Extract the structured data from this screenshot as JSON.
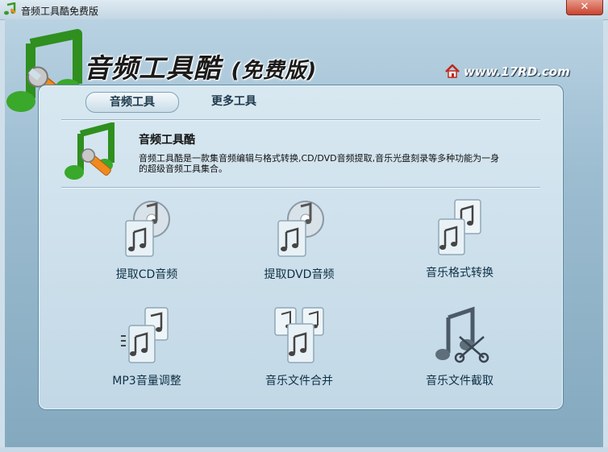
{
  "window": {
    "title": "音频工具酷免费版",
    "close_label": "✕"
  },
  "header": {
    "app_title": "音频工具酷",
    "app_title_sub": "(免费版)",
    "site": "www.17RD.com"
  },
  "tabs": [
    {
      "label": "音频工具",
      "active": true
    },
    {
      "label": "更多工具",
      "active": false
    }
  ],
  "intro": {
    "title": "音频工具酷",
    "description": "音频工具酷是一款集音频编辑与格式转换,CD/DVD音频提取,音乐光盘刻录等多种功能为一身的超级音频工具集合。"
  },
  "tools": [
    {
      "label": "提取CD音频",
      "icon": "cd-extract-icon"
    },
    {
      "label": "提取DVD音频",
      "icon": "dvd-extract-icon"
    },
    {
      "label": "音乐格式转换",
      "icon": "format-convert-icon"
    },
    {
      "label": "MP3音量调整",
      "icon": "volume-adjust-icon"
    },
    {
      "label": "音乐文件合并",
      "icon": "file-merge-icon"
    },
    {
      "label": "音乐文件截取",
      "icon": "file-cut-icon"
    }
  ],
  "colors": {
    "panel_bg": "#c2d8e6",
    "accent": "#1e3a4d",
    "icon_green": "#4aa82e",
    "icon_orange": "#f08a1e"
  }
}
